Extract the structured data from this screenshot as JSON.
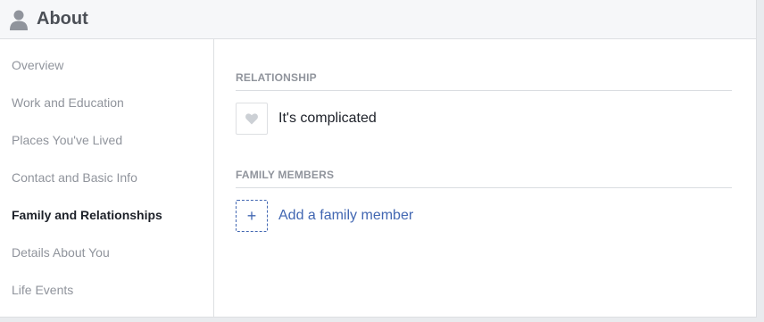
{
  "header": {
    "title": "About",
    "icon": "person-icon"
  },
  "sidebar": {
    "items": [
      {
        "label": "Overview",
        "active": false
      },
      {
        "label": "Work and Education",
        "active": false
      },
      {
        "label": "Places You've Lived",
        "active": false
      },
      {
        "label": "Contact and Basic Info",
        "active": false
      },
      {
        "label": "Family and Relationships",
        "active": true
      },
      {
        "label": "Details About You",
        "active": false
      },
      {
        "label": "Life Events",
        "active": false
      }
    ]
  },
  "main": {
    "relationship": {
      "section_title": "RELATIONSHIP",
      "status": "It's complicated",
      "icon": "heart-icon"
    },
    "family": {
      "section_title": "FAMILY MEMBERS",
      "add_label": "Add a family member",
      "add_symbol": "+",
      "icon": "plus-icon"
    }
  },
  "colors": {
    "link": "#4267b2",
    "muted": "#90949c",
    "text": "#1d2129",
    "header_bg": "#f6f7f9"
  }
}
